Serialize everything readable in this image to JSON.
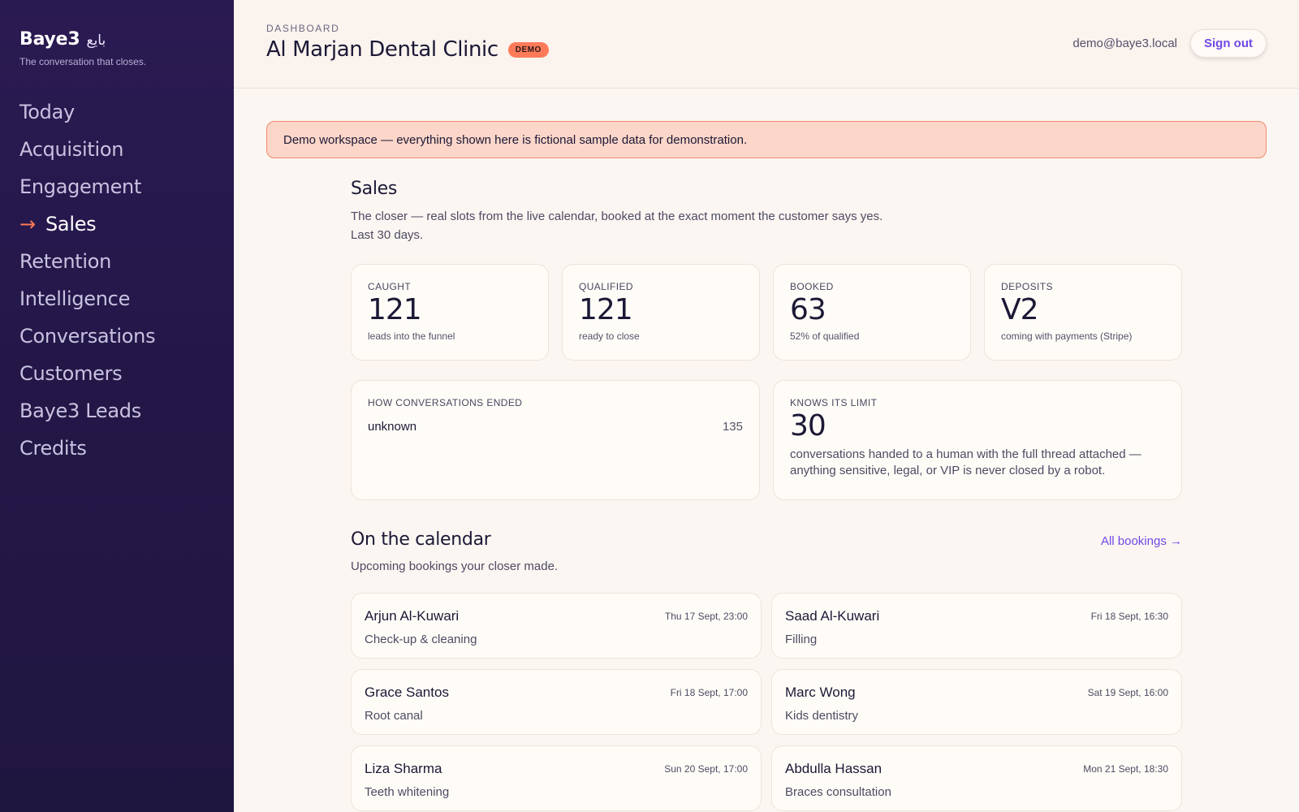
{
  "sidebar": {
    "brand": "Baye3",
    "brand_arabic": "بايع",
    "tagline": "The conversation that closes.",
    "active_arrow": "→",
    "items": [
      {
        "label": "Today"
      },
      {
        "label": "Acquisition"
      },
      {
        "label": "Engagement"
      },
      {
        "label": "Sales",
        "active": true
      },
      {
        "label": "Retention"
      },
      {
        "label": "Intelligence"
      },
      {
        "label": "Conversations"
      },
      {
        "label": "Customers"
      },
      {
        "label": "Baye3 Leads"
      },
      {
        "label": "Credits"
      }
    ]
  },
  "header": {
    "eyebrow": "DASHBOARD",
    "title": "Al Marjan Dental Clinic",
    "badge": "DEMO",
    "user_email": "demo@baye3.local",
    "signout_label": "Sign out"
  },
  "banner": {
    "text": "Demo workspace — everything shown here is fictional sample data for demonstration."
  },
  "sales": {
    "title": "Sales",
    "description": "The closer — real slots from the live calendar, booked at the exact moment the customer says yes.",
    "period": "Last 30 days.",
    "stats": [
      {
        "label": "CAUGHT",
        "value": "121",
        "sub": "leads into the funnel"
      },
      {
        "label": "QUALIFIED",
        "value": "121",
        "sub": "ready to close"
      },
      {
        "label": "BOOKED",
        "value": "63",
        "sub": "52% of qualified"
      },
      {
        "label": "DEPOSITS",
        "value": "V2",
        "sub": "coming with payments (Stripe)"
      }
    ],
    "ended": {
      "label": "HOW CONVERSATIONS ENDED",
      "rows": [
        {
          "name": "unknown",
          "count": "135"
        }
      ]
    },
    "limit": {
      "label": "KNOWS ITS LIMIT",
      "value": "30",
      "description": "conversations handed to a human with the full thread attached — anything sensitive, legal, or VIP is never closed by a robot."
    }
  },
  "calendar": {
    "title": "On the calendar",
    "link": "All bookings →",
    "description": "Upcoming bookings your closer made.",
    "bookings": [
      {
        "name": "Arjun Al-Kuwari",
        "service": "Check-up & cleaning",
        "time": "Thu 17 Sept, 23:00"
      },
      {
        "name": "Saad Al-Kuwari",
        "service": "Filling",
        "time": "Fri 18 Sept, 16:30"
      },
      {
        "name": "Grace Santos",
        "service": "Root canal",
        "time": "Fri 18 Sept, 17:00"
      },
      {
        "name": "Marc Wong",
        "service": "Kids dentistry",
        "time": "Sat 19 Sept, 16:00"
      },
      {
        "name": "Liza Sharma",
        "service": "Teeth whitening",
        "time": "Sun 20 Sept, 17:00"
      },
      {
        "name": "Abdulla Hassan",
        "service": "Braces consultation",
        "time": "Mon 21 Sept, 18:30"
      }
    ]
  },
  "colors": {
    "sidebar_bg": "#241748",
    "accent_orange": "#ff7a59",
    "accent_purple": "#7048e8",
    "banner_bg": "#fbd6c9"
  }
}
